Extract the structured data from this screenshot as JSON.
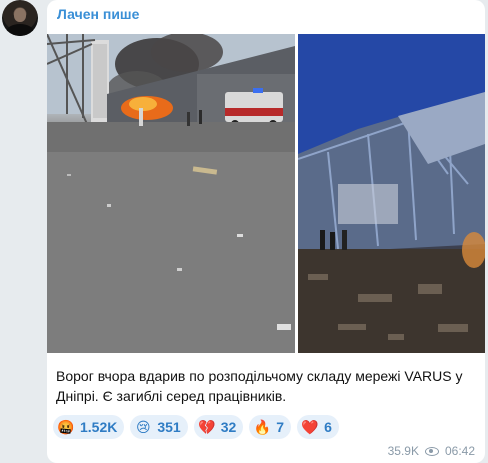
{
  "post": {
    "author": "Лачен пише",
    "text": "Ворог вчора вдарив по розподільчому складу мережі VARUS у Дніпрі. Є загиблі серед працівників.",
    "views": "35.9K",
    "time": "06:42"
  },
  "photos": [
    {
      "name": "photo-warehouse-fire"
    },
    {
      "name": "photo-warehouse-ruins"
    }
  ],
  "reactions": [
    {
      "emoji": "🤬",
      "icon": "angry-face-icon",
      "count": "1.52K"
    },
    {
      "emoji": "😢",
      "icon": "crying-face-icon",
      "count": "351"
    },
    {
      "emoji": "💔",
      "icon": "broken-heart-icon",
      "count": "32"
    },
    {
      "emoji": "🔥",
      "icon": "fire-icon",
      "count": "7"
    },
    {
      "emoji": "❤️",
      "icon": "heart-icon",
      "count": "6"
    }
  ],
  "colors": {
    "author": "#3a8fd6",
    "reaction_bg": "#e6f0fa",
    "reaction_text": "#2f7cc4",
    "meta": "#8a9aa8"
  }
}
